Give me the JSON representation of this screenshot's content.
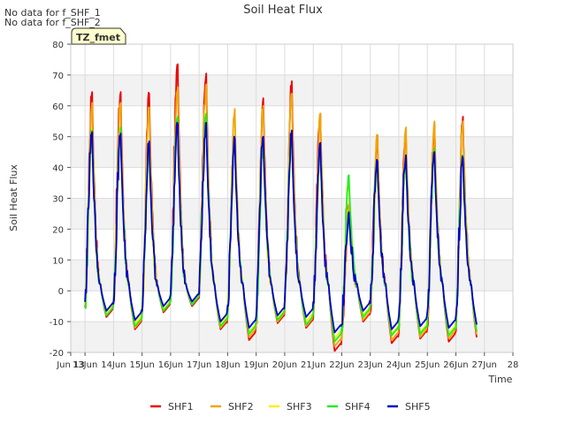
{
  "notes": [
    "No data for f_SHF_1",
    "No data for f_SHF_2"
  ],
  "badge": "TZ_fmet",
  "chart_data": {
    "type": "line",
    "title": "Soil Heat Flux",
    "xlabel": "Time",
    "ylabel": "Soil Heat Flux",
    "xlim": [
      12.5,
      28
    ],
    "ylim": [
      -20,
      80
    ],
    "x_ticks": [
      12.5,
      13,
      14,
      15,
      16,
      17,
      18,
      19,
      20,
      21,
      22,
      23,
      24,
      25,
      26,
      27,
      28
    ],
    "x_tick_labels": [
      "Jun 13",
      "13Jun",
      "14Jun",
      "15Jun",
      "16Jun",
      "17Jun",
      "18Jun",
      "19Jun",
      "20Jun",
      "21Jun",
      "22Jun",
      "23Jun",
      "24Jun",
      "25Jun",
      "26Jun",
      "27Jun",
      "28"
    ],
    "y_ticks": [
      -20,
      -10,
      0,
      10,
      20,
      30,
      40,
      50,
      60,
      70,
      80
    ],
    "grid": true,
    "legend_position": "bottom",
    "days": [
      13,
      14,
      15,
      16,
      17,
      18,
      19,
      20,
      21,
      22,
      23,
      24,
      25,
      26
    ],
    "series": [
      {
        "name": "SHF1",
        "color": "#ee0000",
        "peaks": [
          64.5,
          64.5,
          64,
          73.5,
          70.5,
          50,
          62.5,
          68,
          57.5,
          28,
          50.5,
          50.5,
          54,
          56.5
        ],
        "troughs": [
          -11,
          -8.5,
          -12.5,
          -7,
          -5,
          -12.5,
          -16,
          -10.5,
          -12,
          -19.5,
          -10,
          -17,
          -15.5,
          -16.5
        ]
      },
      {
        "name": "SHF2",
        "color": "#f0a500",
        "peaks": [
          61,
          61,
          59.5,
          66,
          67,
          59,
          60,
          64,
          57.5,
          28,
          50.5,
          53,
          55,
          55
        ],
        "troughs": [
          -10.5,
          -8,
          -12,
          -6.5,
          -4.5,
          -12,
          -15,
          -10,
          -11.5,
          -18,
          -9.5,
          -16,
          -15,
          -15.5
        ]
      },
      {
        "name": "SHF3",
        "color": "#ffee00",
        "peaks": [
          51,
          52,
          47,
          56,
          57,
          48,
          48,
          51,
          46,
          36,
          41,
          43,
          44,
          43
        ],
        "troughs": [
          -9.5,
          -7,
          -10.5,
          -6,
          -4,
          -10.5,
          -13.5,
          -9,
          -10,
          -15.5,
          -8,
          -14,
          -13.5,
          -14
        ]
      },
      {
        "name": "SHF4",
        "color": "#22ee22",
        "peaks": [
          52,
          53,
          48,
          56.5,
          57.5,
          49,
          49,
          52,
          47.5,
          37.5,
          42,
          44,
          46,
          44
        ],
        "troughs": [
          -10,
          -8,
          -11.5,
          -6.5,
          -4.5,
          -11.5,
          -14,
          -9.5,
          -11,
          -16.5,
          -8.5,
          -14.5,
          -14,
          -14.5
        ]
      },
      {
        "name": "SHF5",
        "color": "#0000cc",
        "peaks": [
          51.5,
          51,
          48.5,
          54,
          54.5,
          49.5,
          50,
          52,
          48,
          25.5,
          42,
          44,
          45,
          43
        ],
        "troughs": [
          -8,
          -6.5,
          -9.5,
          -5,
          -3.5,
          -10,
          -12,
          -8,
          -8.5,
          -13.5,
          -6.5,
          -12.5,
          -11.5,
          -12
        ]
      }
    ]
  }
}
